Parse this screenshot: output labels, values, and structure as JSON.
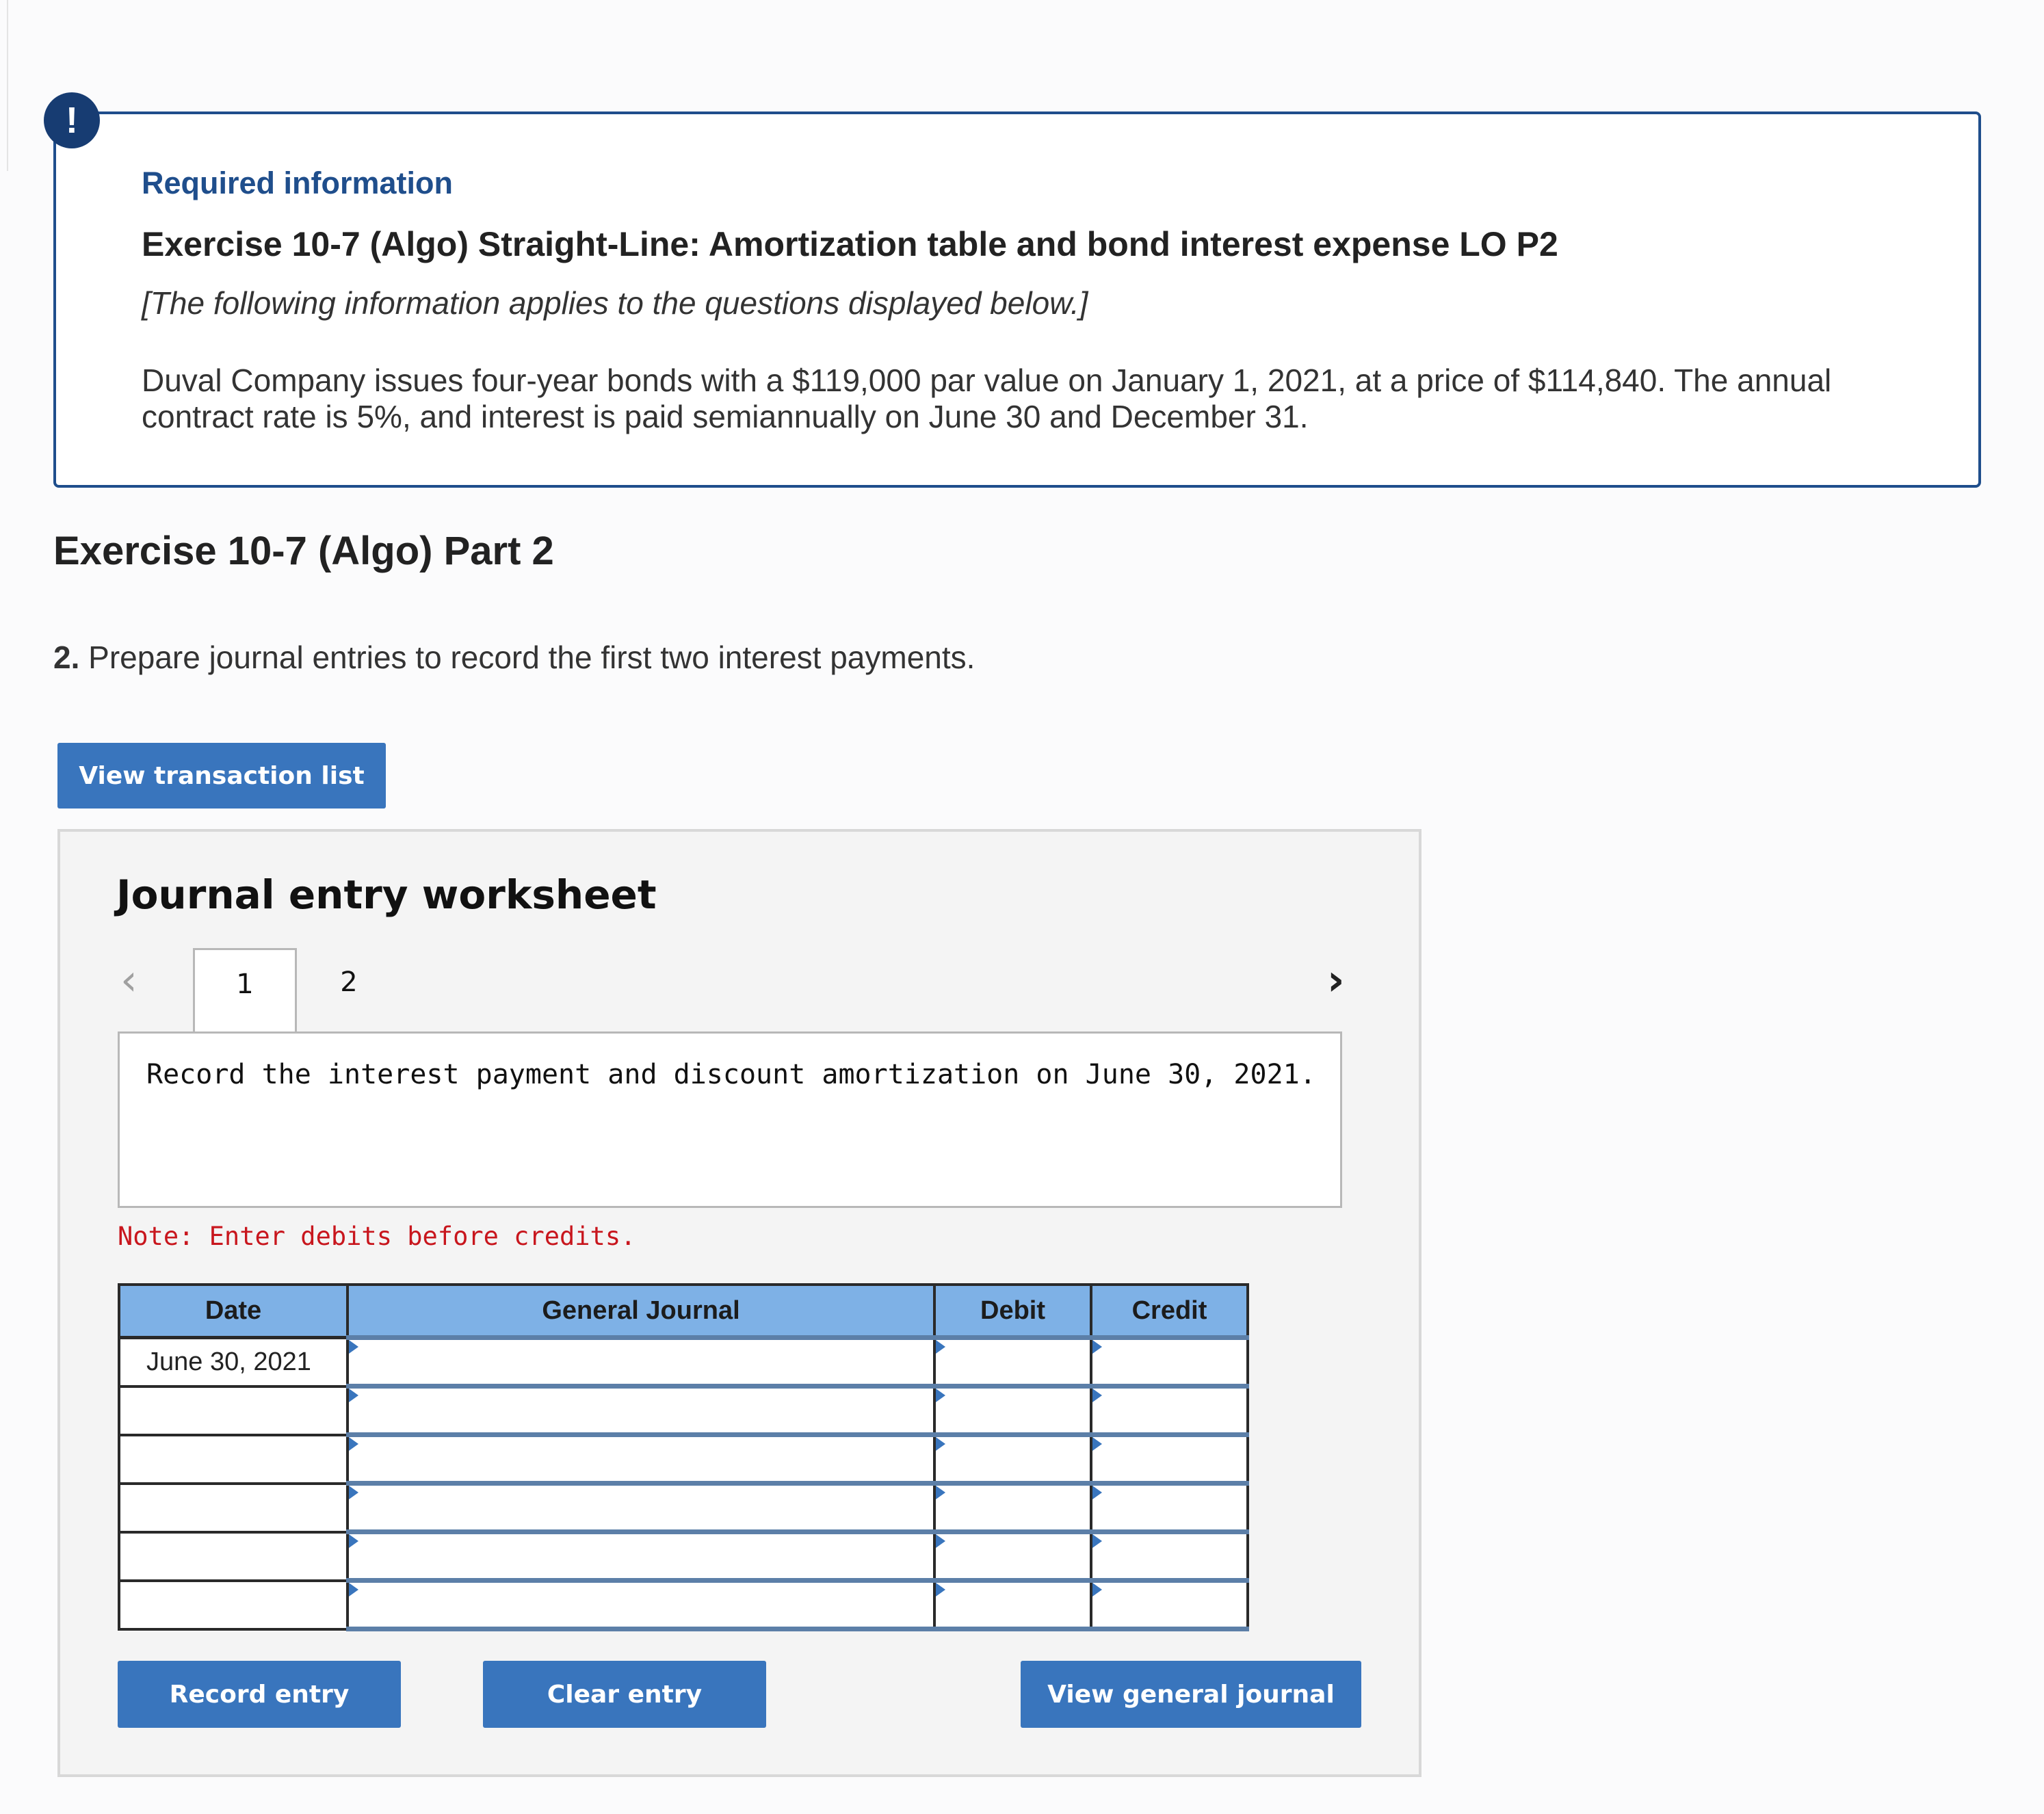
{
  "info": {
    "required_label": "Required information",
    "exercise_title": "Exercise 10-7 (Algo) Straight-Line: Amortization table and bond interest expense LO P2",
    "subtitle": "[The following information applies to the questions displayed below.]",
    "body": "Duval Company issues four-year bonds with a $119,000 par value on January 1, 2021, at a price of $114,840. The annual contract rate is 5%, and interest is paid semiannually on June 30 and December 31.",
    "alert_symbol": "!"
  },
  "part_title": "Exercise 10-7 (Algo) Part 2",
  "question": {
    "number": "2.",
    "text": " Prepare journal entries to record the first two interest payments."
  },
  "buttons": {
    "view_transaction_list": "View transaction list",
    "record_entry": "Record entry",
    "clear_entry": "Clear entry",
    "view_general_journal": "View general journal"
  },
  "worksheet": {
    "title": "Journal entry worksheet",
    "tabs": [
      "1",
      "2"
    ],
    "active_tab": "1",
    "instruction": "Record the interest payment and discount amortization on June 30, 2021.",
    "note": "Note: Enter debits before credits.",
    "nav_prev": "‹",
    "nav_next": "›"
  },
  "journal": {
    "headers": {
      "date": "Date",
      "general_journal": "General Journal",
      "debit": "Debit",
      "credit": "Credit"
    },
    "rows": [
      {
        "date": "June 30, 2021",
        "account": "",
        "debit": "",
        "credit": ""
      },
      {
        "date": "",
        "account": "",
        "debit": "",
        "credit": ""
      },
      {
        "date": "",
        "account": "",
        "debit": "",
        "credit": ""
      },
      {
        "date": "",
        "account": "",
        "debit": "",
        "credit": ""
      },
      {
        "date": "",
        "account": "",
        "debit": "",
        "credit": ""
      },
      {
        "date": "",
        "account": "",
        "debit": "",
        "credit": ""
      }
    ]
  },
  "colors": {
    "accent_blue": "#3975bd",
    "card_border": "#1f4e8c",
    "header_blue": "#7eb1e6",
    "note_red": "#c8161d"
  },
  "icons": {
    "alert": "exclamation-circle-icon",
    "prev": "chevron-left-icon",
    "next": "chevron-right-icon"
  }
}
